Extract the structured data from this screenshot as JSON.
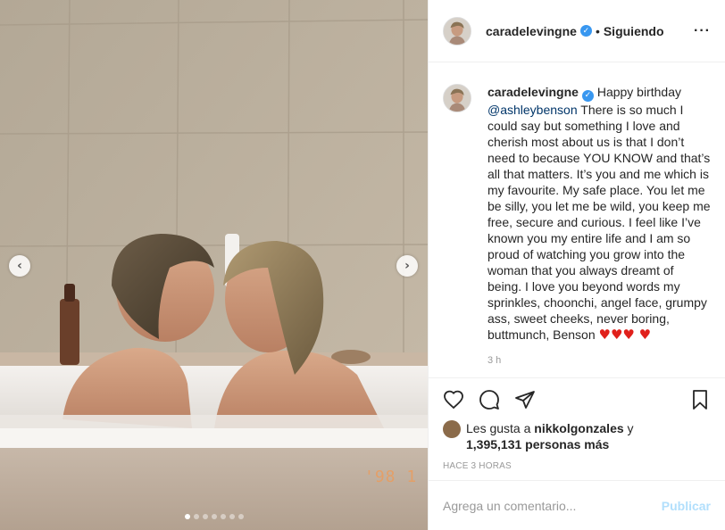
{
  "post": {
    "author": "caradelevingne",
    "follow_status": "Siguiendo",
    "separator": "•",
    "caption": {
      "author": "caradelevingne",
      "greeting": "Happy birthday",
      "mention": "@ashleybenson",
      "text": "There is so much I could say but something I love and cherish most about us is that I don’t need to because YOU KNOW and that’s all that matters. It’s you and me which is my favourite. My safe place. You let me be silly, you let me be wild, you keep me free, secure and curious. I feel like I’ve known you my entire life and I am so proud of watching you grow into the woman that you always dreamt of being. I love you beyond words my sprinkles, choonchi, angel face, grumpy ass, sweet cheeks, never boring, buttmunch, Benson",
      "hearts": "♥♥♥ ♥",
      "time": "3 h"
    },
    "likes": {
      "prefix": "Les gusta a",
      "liker": "nikkolgonzales",
      "connector": "y",
      "count": "1,395,131 personas más"
    },
    "posted_ago": "HACE 3 HORAS",
    "comment_input": {
      "placeholder": "Agrega un comentario...",
      "value": ""
    },
    "publish_label": "Publicar",
    "media": {
      "film_stamp": "'98 1",
      "carousel": {
        "total": 7,
        "active": 1
      }
    }
  },
  "icons": {
    "more": "more-options-icon",
    "like": "heart-icon",
    "comment": "comment-icon",
    "share": "share-icon",
    "save": "bookmark-icon",
    "prev": "chevron-left-icon",
    "next": "chevron-right-icon",
    "verified": "verified-badge-icon"
  },
  "colors": {
    "verified": "#3897f0",
    "mention": "#003569",
    "publish": "#b2dffc",
    "heart": "#e0201b"
  }
}
